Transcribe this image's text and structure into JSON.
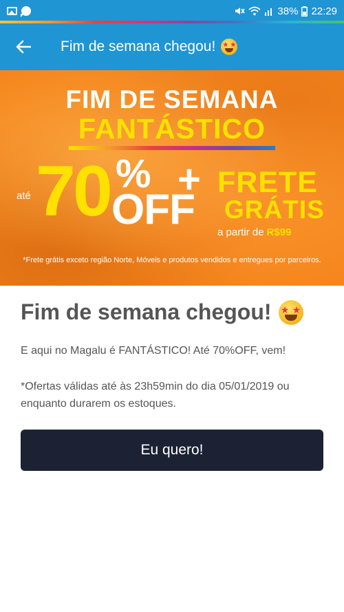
{
  "status_bar": {
    "battery": "38%",
    "time": "22:29"
  },
  "app_bar": {
    "title": "Fim de semana chegou!",
    "emoji": "star-struck"
  },
  "banner": {
    "line1": "FIM DE SEMANA",
    "line2": "FANTÁSTICO",
    "ate": "até",
    "discount": "70",
    "percent": "%",
    "off": "OFF",
    "plus": "+",
    "frete": "FRETE",
    "gratis": "GRÁTIS",
    "asterisk": "*",
    "a_partir": "a partir de",
    "price": "R$99",
    "note": "*Frete grátis exceto região Norte, Móveis e produtos vendidos e entregues por parceiros."
  },
  "content": {
    "title": "Fim de semana chegou!",
    "paragraph1": "E aqui no Magalu é FANTÁSTICO! Até 70%OFF, vem!",
    "paragraph2": "*Ofertas válidas até às 23h59min do dia 05/01/2019 ou enquanto durarem os estoques.",
    "cta_label": "Eu quero!"
  },
  "colors": {
    "primary": "#1f95d3",
    "banner_orange": "#f5851c",
    "highlight_yellow": "#ffe100",
    "button_dark": "#1c2234",
    "text_gray": "#555555"
  }
}
